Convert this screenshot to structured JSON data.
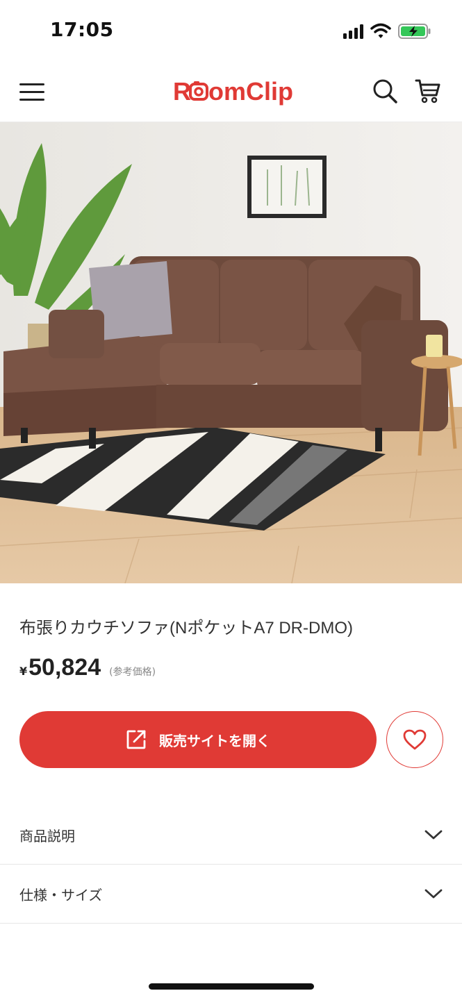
{
  "status_bar": {
    "time": "17:05",
    "icons": [
      "cellular-signal-icon",
      "wifi-icon",
      "battery-charging-icon"
    ],
    "battery_color": "#34c759"
  },
  "header": {
    "logo_text": "RoomClip",
    "brand_color": "#e03a35",
    "icons": [
      "menu-icon",
      "search-icon",
      "cart-icon"
    ]
  },
  "product": {
    "image_alt": "brown-fabric-couch-sofa-photo",
    "title": "布張りカウチソファ(NポケットA7 DR-DMO)",
    "price_currency": "¥",
    "price_value": "50,824",
    "price_note": "(参考価格)"
  },
  "actions": {
    "open_site_label": "販売サイトを開く",
    "open_site_icon": "external-link-icon",
    "favorite_icon": "heart-icon",
    "accent_color": "#e03a35"
  },
  "accordions": [
    {
      "label": "商品説明",
      "icon": "chevron-down-icon"
    },
    {
      "label": "仕様・サイズ",
      "icon": "chevron-down-icon"
    }
  ]
}
